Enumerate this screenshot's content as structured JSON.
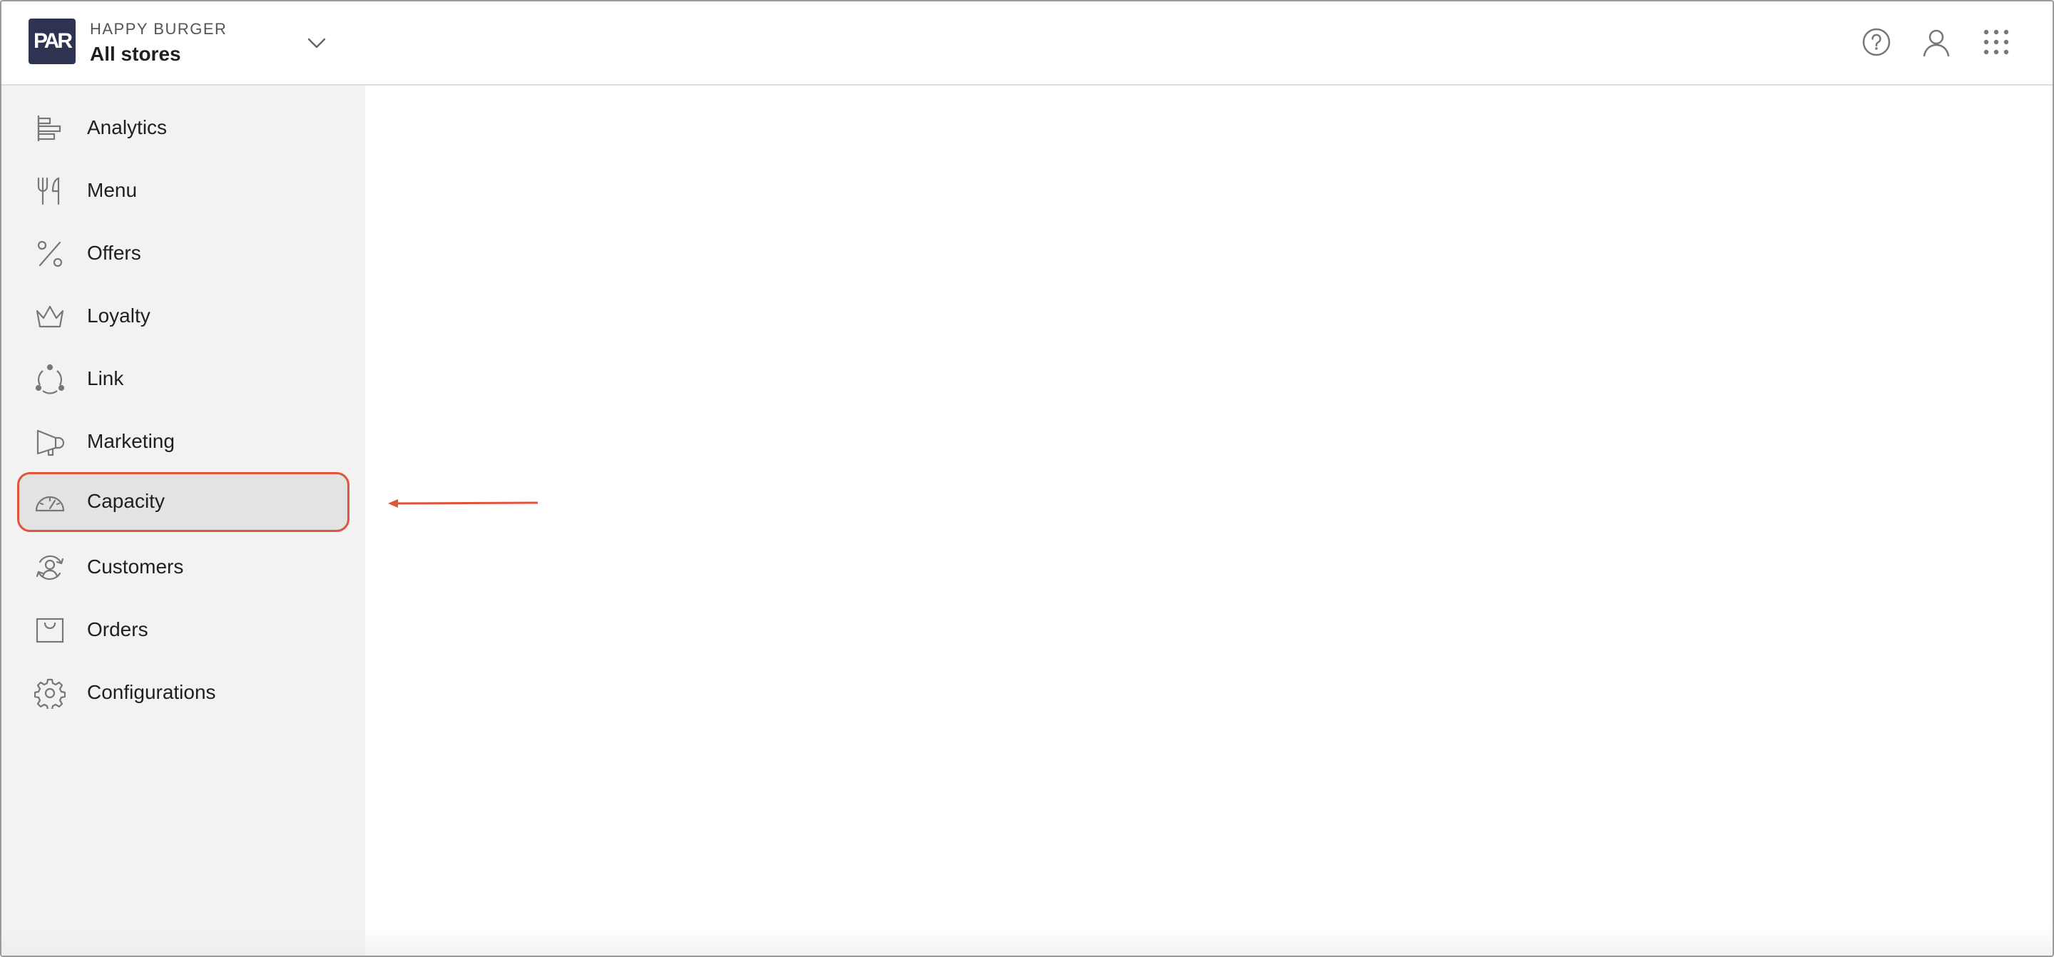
{
  "header": {
    "logo_text": "PAR",
    "brand": "HAPPY BURGER",
    "store_selector": "All stores",
    "icons": [
      "chevron-down-icon",
      "help-icon",
      "user-icon",
      "app-grid-icon"
    ]
  },
  "sidebar": {
    "items": [
      {
        "label": "Analytics",
        "icon": "analytics-icon"
      },
      {
        "label": "Menu",
        "icon": "fork-knife-icon"
      },
      {
        "label": "Offers",
        "icon": "percent-icon"
      },
      {
        "label": "Loyalty",
        "icon": "crown-icon"
      },
      {
        "label": "Link",
        "icon": "link-circle-icon"
      },
      {
        "label": "Marketing",
        "icon": "megaphone-icon"
      },
      {
        "label": "Capacity",
        "icon": "gauge-icon",
        "selected": true
      },
      {
        "label": "Customers",
        "icon": "customer-refresh-icon"
      },
      {
        "label": "Orders",
        "icon": "bag-icon"
      },
      {
        "label": "Configurations",
        "icon": "gear-icon"
      }
    ]
  },
  "colors": {
    "logo_bg": "#2f3352",
    "sidebar_bg": "#f2f2f2",
    "highlight_border": "#e2533b",
    "annotation_arrow": "#e2533b",
    "icon_stroke": "#777777"
  }
}
